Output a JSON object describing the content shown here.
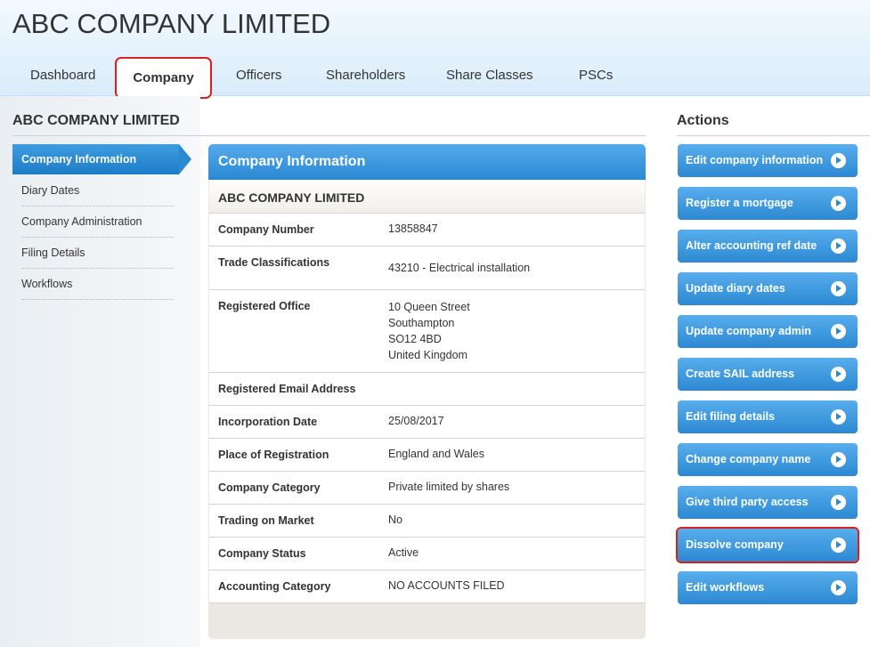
{
  "app": {
    "title": "ABC COMPANY LIMITED"
  },
  "nav": {
    "tabs": [
      "Dashboard",
      "Company",
      "Officers",
      "Shareholders",
      "Share Classes",
      "PSCs"
    ],
    "active": "Company"
  },
  "sidebar": {
    "heading": "ABC COMPANY LIMITED",
    "items": [
      "Company Information",
      "Diary Dates",
      "Company Administration",
      "Filing Details",
      "Workflows"
    ]
  },
  "panel": {
    "title": "Company Information",
    "company_name": "ABC COMPANY LIMITED",
    "rows": [
      {
        "label": "Company Number",
        "value": [
          "13858847"
        ]
      },
      {
        "label": "Trade Classifications",
        "value": [
          "43210 - Electrical installation"
        ]
      },
      {
        "label": "Registered Office",
        "value": [
          "10 Queen Street",
          "Southampton",
          "SO12 4BD",
          "United Kingdom"
        ]
      },
      {
        "label": "Registered Email Address",
        "value": []
      },
      {
        "label": "Incorporation Date",
        "value": [
          "25/08/2017"
        ]
      },
      {
        "label": "Place of Registration",
        "value": [
          "England and Wales"
        ]
      },
      {
        "label": "Company Category",
        "value": [
          "Private limited by shares"
        ]
      },
      {
        "label": "Trading on Market",
        "value": [
          "No"
        ]
      },
      {
        "label": "Company Status",
        "value": [
          "Active"
        ]
      },
      {
        "label": "Accounting Category",
        "value": [
          "NO ACCOUNTS FILED"
        ]
      }
    ]
  },
  "actions": {
    "heading": "Actions",
    "buttons": [
      "Edit company information",
      "Register a mortgage",
      "Alter accounting ref date",
      "Update diary dates",
      "Update company admin",
      "Create SAIL address",
      "Edit filing details",
      "Change company name",
      "Give third party access",
      "Dissolve company",
      "Edit workflows"
    ],
    "highlighted": "Dissolve company"
  },
  "colors": {
    "accent": "#2b88d2",
    "highlight": "#d9201f"
  }
}
